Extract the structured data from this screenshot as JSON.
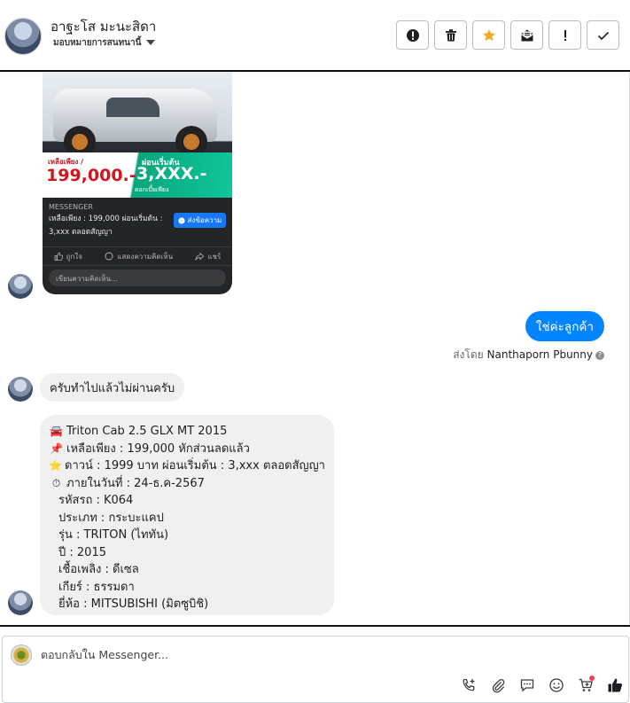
{
  "header": {
    "contact_name": "อาฐะโส มะนะสิดา",
    "assign_label": "มอบหมายการสนทนานี้",
    "actions": [
      {
        "name": "spam-icon",
        "label": "!"
      },
      {
        "name": "trash-icon",
        "label": ""
      },
      {
        "name": "star-icon",
        "label": ""
      },
      {
        "name": "mark-unread-icon",
        "label": ""
      },
      {
        "name": "follow-up-icon",
        "label": "!"
      },
      {
        "name": "done-check-icon",
        "label": ""
      }
    ],
    "star_color": "#f5a623"
  },
  "post": {
    "banner_lead": "เหลือเพียง /",
    "banner_price": "199,000.-",
    "banner_installment_lead": "ผ่อนเริ่มต้น",
    "banner_installment": "3,XXX.-",
    "banner_sub": "ดอกเบี้ยเพียง",
    "source": "MESSENGER",
    "description": "เหลือเพียง : 199,000 ผ่อนเริ่มต้น : 3,xxx ตลอดสัญญา",
    "send_button": "ส่งข้อความ",
    "like": "ถูกใจ",
    "comment": "แสดงความคิดเห็น",
    "share": "แชร์",
    "comment_placeholder": "เขียนความคิดเห็น..."
  },
  "messages": {
    "outgoing": "ใช่ค่ะลูกค้า",
    "sent_by_prefix": "ส่งโดย",
    "sent_by_name": "Nanthaporn Pbunny",
    "incoming_short": "ครับทำไปแล้วไม่ผ่านครับ",
    "incoming_long": [
      {
        "icon": "🚘",
        "text": "Triton Cab 2.5 GLX MT 2015"
      },
      {
        "icon": "📌",
        "text": "เหลือเพียง : 199,000 หักส่วนลดแล้ว"
      },
      {
        "icon": "⭐",
        "text": "ดาวน์ : 1999 บาท ผ่อนเริ่มต้น : 3,xxx ตลอดสัญญา"
      },
      {
        "icon": "⏱",
        "text": "ภายในวันที่ : 24-ธ.ค-2567"
      },
      {
        "icon": "",
        "text": "รหัสรถ : K064"
      },
      {
        "icon": "",
        "text": "ประเภท : กระบะแคป"
      },
      {
        "icon": "",
        "text": "รุ่น : TRITON (ไททัน)"
      },
      {
        "icon": "",
        "text": "ปี : 2015"
      },
      {
        "icon": "",
        "text": "เชื้อเพลิง : ดีเซล"
      },
      {
        "icon": "",
        "text": "เกียร์ : ธรรมดา"
      },
      {
        "icon": "",
        "text": "ยี่ห้อ : MITSUBISHI (มิตซูบิชิ)"
      }
    ]
  },
  "composer": {
    "placeholder": "ตอบกลับใน Messenger...",
    "tools": [
      "call-icon",
      "attachment-icon",
      "saved-reply-icon",
      "emoji-icon",
      "shop-cart-icon",
      "thumbs-up-icon"
    ],
    "accent": "#0084ff"
  }
}
